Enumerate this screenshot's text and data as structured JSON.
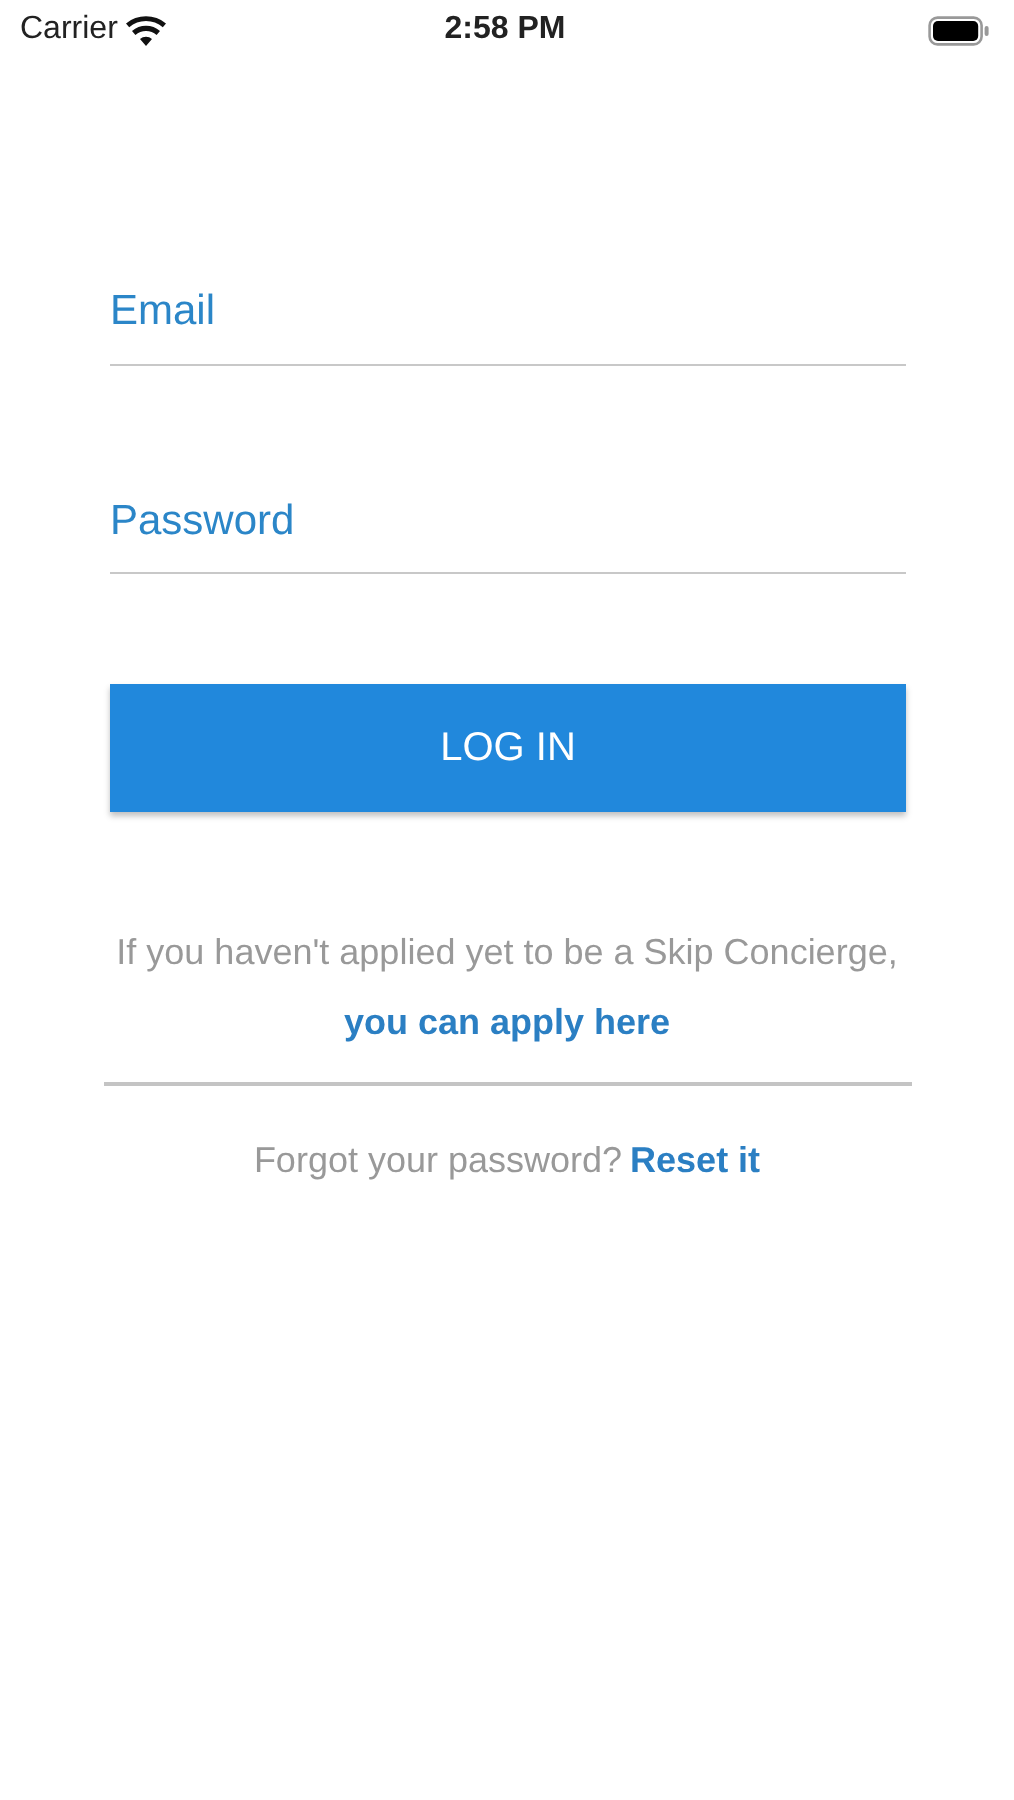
{
  "status_bar": {
    "carrier": "Carrier",
    "time": "2:58 PM"
  },
  "fields": [
    {
      "placeholder": "Email"
    },
    {
      "placeholder": "Password"
    }
  ],
  "login_button": "LOG IN",
  "apply_text": "If you haven't applied yet to be a Skip Concierge,",
  "apply_link": "you can apply here",
  "forgot_text": "Forgot your password?",
  "reset_link": "Reset it"
}
